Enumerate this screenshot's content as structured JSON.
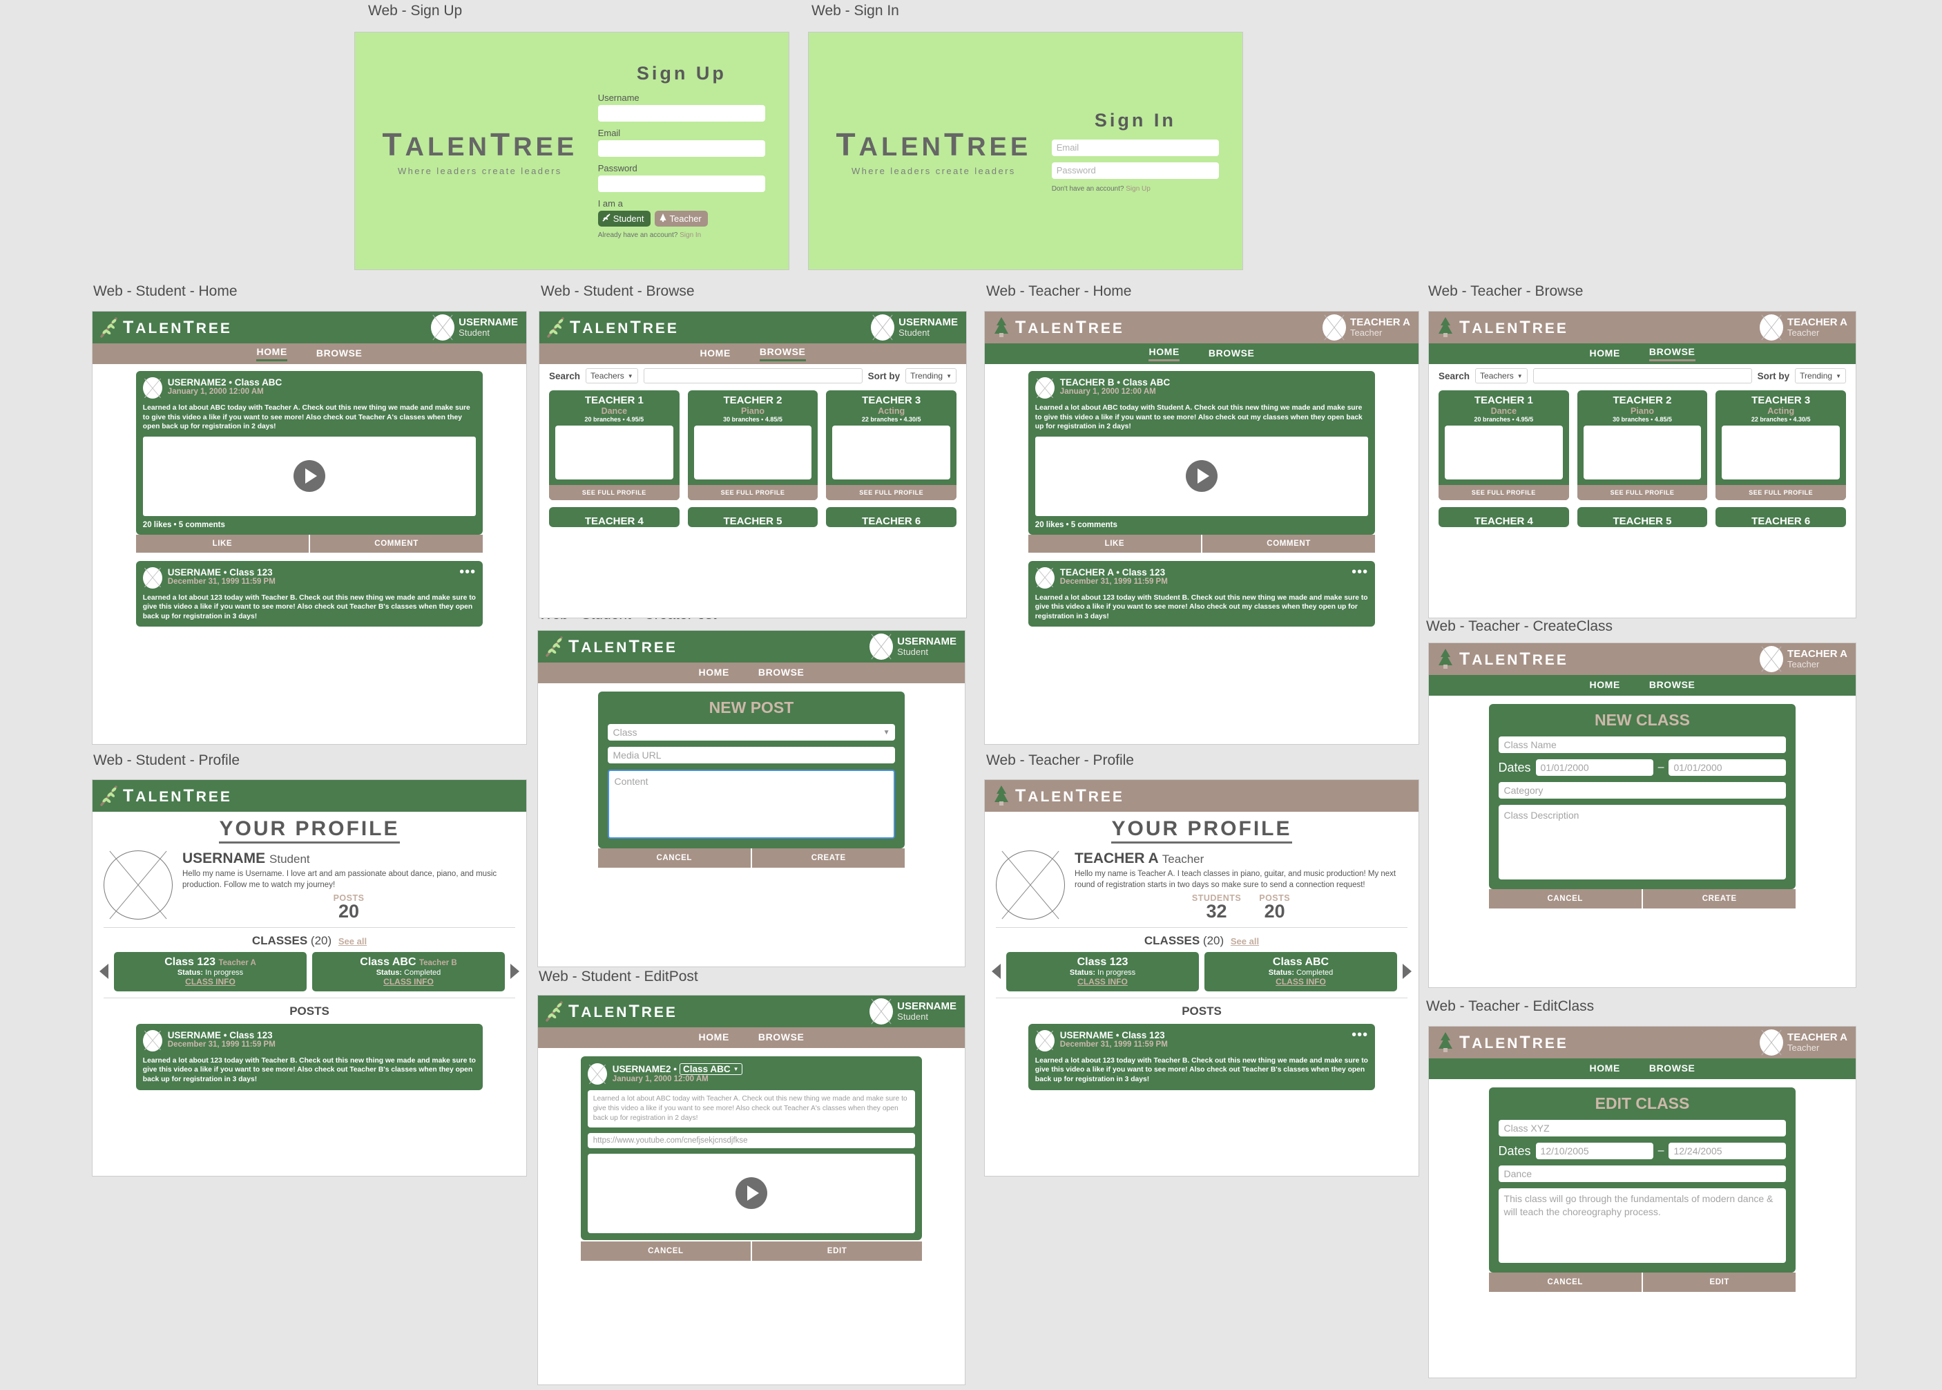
{
  "brand": {
    "name_cap1": "T",
    "name_rest1": "ALEN",
    "name_cap2": "T",
    "name_rest2": "REE",
    "wordmark": "TalenTree",
    "tagline": "Where leaders create leaders",
    "colors": {
      "green": "#4a7c4e",
      "brown": "#a79287",
      "lightgreen": "#bdeb9a",
      "accent_tan": "#c3ad9f"
    }
  },
  "panels": {
    "signup": "Web - Sign Up",
    "signin": "Web - Sign In",
    "student_home": "Web - Student - Home",
    "student_browse": "Web - Student - Browse",
    "student_createpost": "Web - Student - CreatePost",
    "student_editpost": "Web - Student - EditPost",
    "student_profile": "Web - Student - Profile",
    "teacher_home": "Web - Teacher - Home",
    "teacher_browse": "Web - Teacher - Browse",
    "teacher_profile": "Web - Teacher - Profile",
    "teacher_createclass": "Web - Teacher - CreateClass",
    "teacher_editclass": "Web - Teacher - EditClass"
  },
  "signup": {
    "title": "Sign Up",
    "username_label": "Username",
    "email_label": "Email",
    "password_label": "Password",
    "username_value": "",
    "email_value": "",
    "password_value": "",
    "role_label": "I am a",
    "role_student": "Student",
    "role_teacher": "Teacher",
    "footer_text": "Already have an account?",
    "footer_link": "Sign In"
  },
  "signin": {
    "title": "Sign In",
    "email_placeholder": "Email",
    "password_placeholder": "Password",
    "footer_text": "Don't have an account?",
    "footer_link": "Sign Up"
  },
  "nav": {
    "home": "HOME",
    "browse": "BROWSE"
  },
  "student_user": {
    "name": "USERNAME",
    "role": "Student"
  },
  "teacher_user": {
    "name": "TEACHER A",
    "role": "Teacher"
  },
  "student_home": {
    "posts": [
      {
        "author": "USERNAME2 • Class ABC",
        "date": "January 1, 2000 12:00 AM",
        "body": "Learned a lot about ABC today with Teacher A. Check out this new thing we made and make sure to give this video a like if you want to see more! Also check out Teacher A's classes when they open back up for registration in 2 days!",
        "stats": "20 likes • 5 comments",
        "like": "LIKE",
        "comment": "COMMENT"
      },
      {
        "author": "USERNAME • Class 123",
        "date": "December 31, 1999 11:59 PM",
        "body": "Learned a lot about 123 today with Teacher B. Check out this new thing we made and make sure to give this video a like if you want to see more! Also check out Teacher B's classes when they open back up for registration in 3 days!"
      }
    ]
  },
  "teacher_home": {
    "posts": [
      {
        "author": "TEACHER B • Class ABC",
        "date": "January 1, 2000 12:00 AM",
        "body": "Learned a lot about ABC today with Student A. Check out this new thing we made and make sure to give this video a like if you want to see more! Also check out my classes when they open back up for registration in 2 days!",
        "stats": "20 likes • 5 comments",
        "like": "LIKE",
        "comment": "COMMENT"
      },
      {
        "author": "TEACHER A • Class 123",
        "date": "December 31, 1999 11:59 PM",
        "body": "Learned a lot about 123 today with Student B. Check out this new thing we made and make sure to give this video a like if you want to see more! Also check out my classes when they open up for registration in 3 days!"
      }
    ]
  },
  "browse": {
    "search_label": "Search",
    "search_filter": "Teachers",
    "search_value": "",
    "sort_label": "Sort by",
    "sort_value": "Trending",
    "profile_button": "SEE FULL PROFILE",
    "teachers": [
      {
        "name": "TEACHER 1",
        "category": "Dance",
        "meta": "20 branches • 4.95/5"
      },
      {
        "name": "TEACHER 2",
        "category": "Piano",
        "meta": "30 branches • 4.85/5"
      },
      {
        "name": "TEACHER 3",
        "category": "Acting",
        "meta": "22 branches • 4.30/5"
      }
    ],
    "teachers_row2": [
      {
        "name": "TEACHER 4"
      },
      {
        "name": "TEACHER 5"
      },
      {
        "name": "TEACHER 6"
      }
    ]
  },
  "createpost": {
    "title": "NEW POST",
    "class_placeholder": "Class",
    "media_placeholder": "Media URL",
    "content_placeholder": "Content",
    "cancel": "CANCEL",
    "submit": "CREATE"
  },
  "editpost": {
    "author": "USERNAME2 •",
    "class_chip": "Class ABC",
    "date": "January 1, 2000 12:00 AM",
    "content": "Learned a lot about ABC today with Teacher A. Check out this new thing we made and make sure to give this video a like if you want to see more! Also check out Teacher A's classes when they open back up for registration in 2 days!",
    "media_url": "https://www.youtube.com/cnefjsekjcnsdjfkse",
    "cancel": "CANCEL",
    "submit": "EDIT"
  },
  "createclass": {
    "title": "NEW CLASS",
    "name_placeholder": "Class Name",
    "dates_label": "Dates",
    "date_start": "01/01/2000",
    "date_end": "01/01/2000",
    "dash": "–",
    "category_placeholder": "Category",
    "description_placeholder": "Class Description",
    "cancel": "CANCEL",
    "submit": "CREATE"
  },
  "editclass": {
    "title": "EDIT CLASS",
    "name_value": "Class XYZ",
    "dates_label": "Dates",
    "date_start": "12/10/2005",
    "date_end": "12/24/2005",
    "dash": "–",
    "category_value": "Dance",
    "description_value": "This class will go through the fundamentals of modern dance & will teach the choreography process.",
    "cancel": "CANCEL",
    "submit": "EDIT"
  },
  "student_profile": {
    "title": "Your Profile",
    "name": "USERNAME",
    "role": "Student",
    "bio": "Hello my name is Username. I love art and am passionate about dance, piano, and music production. Follow me to watch my journey!",
    "stats": [
      {
        "label": "POSTS",
        "value": "20"
      }
    ],
    "classes_label": "CLASSES",
    "classes_count": "(20)",
    "see_all": "See all",
    "classes": [
      {
        "name": "Class 123",
        "teacher": "Teacher A",
        "status_label": "Status:",
        "status": "In progress",
        "link": "CLASS INFO"
      },
      {
        "name": "Class ABC",
        "teacher": "Teacher B",
        "status_label": "Status:",
        "status": "Completed",
        "link": "CLASS INFO"
      }
    ],
    "posts_label": "POSTS",
    "post": {
      "author": "USERNAME • Class 123",
      "date": "December 31, 1999 11:59 PM",
      "body": "Learned a lot about 123 today with Teacher B. Check out this new thing we made and make sure to give this video a like if you want to see more! Also check out Teacher B's classes when they open back up for registration in 3 days!"
    }
  },
  "teacher_profile": {
    "title": "Your Profile",
    "name": "TEACHER A",
    "role": "Teacher",
    "bio": "Hello my name is Teacher A. I teach classes in piano, guitar, and music production! My next round of registration starts in two days so make sure to send a connection request!",
    "stats": [
      {
        "label": "STUDENTS",
        "value": "32"
      },
      {
        "label": "POSTS",
        "value": "20"
      }
    ],
    "classes_label": "CLASSES",
    "classes_count": "(20)",
    "see_all": "See all",
    "classes": [
      {
        "name": "Class 123",
        "status_label": "Status:",
        "status": "In progress",
        "link": "CLASS INFO"
      },
      {
        "name": "Class ABC",
        "status_label": "Status:",
        "status": "Completed",
        "link": "CLASS INFO"
      }
    ],
    "posts_label": "POSTS",
    "post": {
      "author": "USERNAME • Class 123",
      "date": "December 31, 1999 11:59 PM",
      "body": "Learned a lot about 123 today with Teacher B. Check out this new thing we made and make sure to give this video a like if you want to see more! Also check out Teacher B's classes when they open back up for registration in 3 days!"
    }
  }
}
